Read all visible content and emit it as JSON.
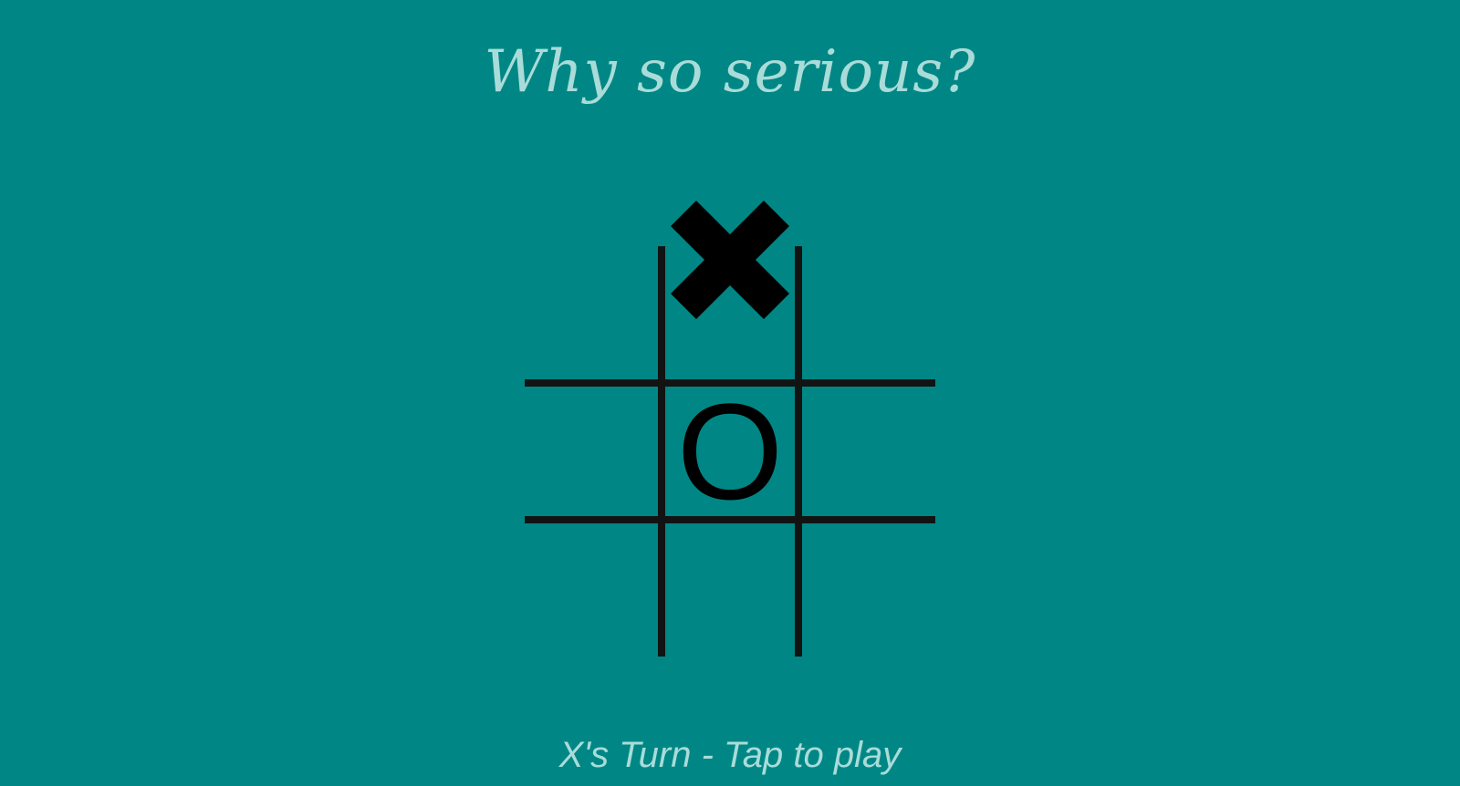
{
  "title": "Why so serious?",
  "status": "X's Turn - Tap to play",
  "board": {
    "cells": [
      "",
      "X",
      "",
      "",
      "O",
      "",
      "",
      "",
      ""
    ]
  },
  "colors": {
    "background": "#008785",
    "text": "#a9dcd9",
    "grid": "#121414",
    "marks": "#000000"
  }
}
